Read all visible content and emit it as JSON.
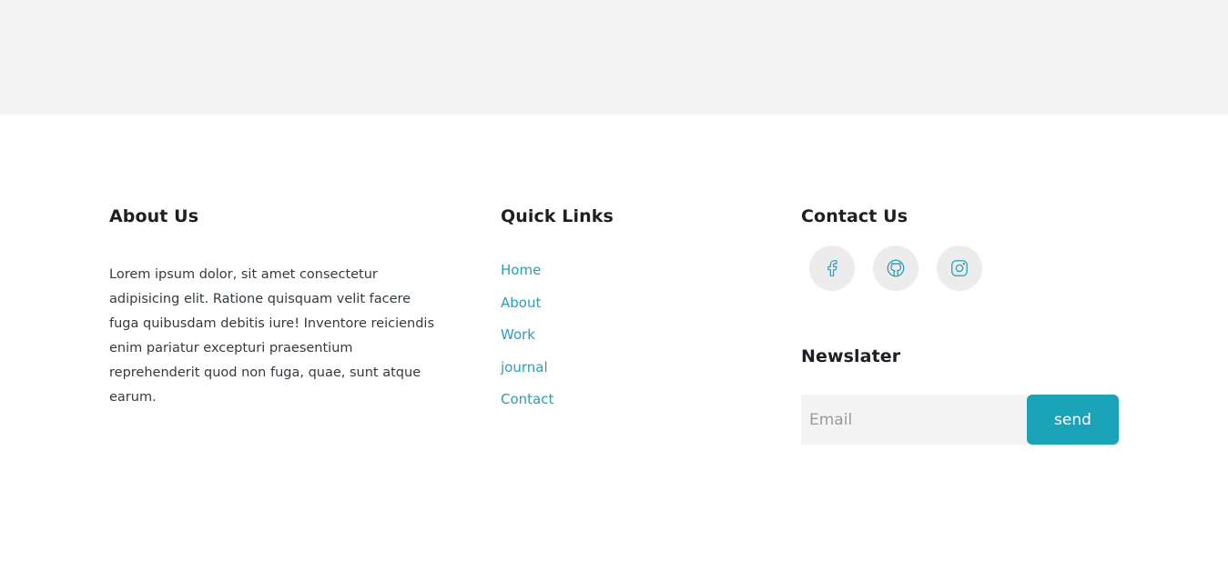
{
  "about": {
    "title": "About Us",
    "text": "Lorem ipsum dolor, sit amet consectetur adipisicing elit. Ratione quisquam velit facere fuga quibusdam debitis iure! Inventore reiciendis enim pariatur excepturi praesentium reprehenderit quod non fuga, quae, sunt atque earum."
  },
  "quick_links": {
    "title": "Quick Links",
    "items": [
      "Home",
      "About",
      "Work",
      "journal",
      "Contact"
    ]
  },
  "contact": {
    "title": "Contact Us",
    "socials": [
      "facebook-icon",
      "github-icon",
      "instagram-icon"
    ]
  },
  "newsletter": {
    "title": "Newslater",
    "email_placeholder": "Email",
    "send_label": "send"
  },
  "colors": {
    "accent": "#1aa3b8",
    "link": "#2a9cb7",
    "band": "#f5f4f5",
    "social_bg": "#ececec"
  }
}
